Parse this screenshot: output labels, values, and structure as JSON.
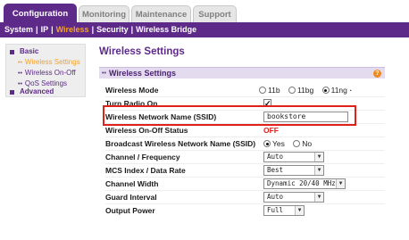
{
  "tabs": [
    {
      "label": "Configuration",
      "active": true
    },
    {
      "label": "Monitoring",
      "active": false
    },
    {
      "label": "Maintenance",
      "active": false
    },
    {
      "label": "Support",
      "active": false
    }
  ],
  "subnav": {
    "items": [
      "System",
      "IP",
      "Wireless",
      "Security",
      "Wireless Bridge"
    ],
    "current": "Wireless"
  },
  "sidebar": {
    "group_basic": "Basic",
    "items": [
      "Wireless Settings",
      "Wireless On-Off",
      "QoS Settings"
    ],
    "active_item": "Wireless Settings",
    "group_advanced": "Advanced"
  },
  "page": {
    "title": "Wireless Settings",
    "panel_title": "Wireless Settings"
  },
  "fields": {
    "wireless_mode": {
      "label": "Wireless Mode",
      "options": [
        "11b",
        "11bg",
        "11ng"
      ],
      "selected": "11ng"
    },
    "turn_radio_on": {
      "label": "Turn Radio On",
      "checked": true
    },
    "ssid": {
      "label": "Wireless Network Name (SSID)",
      "value": "bookstore"
    },
    "onoff_status": {
      "label": "Wireless On-Off Status",
      "value": "OFF"
    },
    "broadcast_ssid": {
      "label": "Broadcast Wireless Network Name (SSID)",
      "options": [
        "Yes",
        "No"
      ],
      "selected": "Yes"
    },
    "channel": {
      "label": "Channel / Frequency",
      "value": "Auto"
    },
    "mcs": {
      "label": "MCS Index / Data Rate",
      "value": "Best"
    },
    "channel_width": {
      "label": "Channel Width",
      "value": "Dynamic 20/40 MHz"
    },
    "guard_interval": {
      "label": "Guard Interval",
      "value": "Auto"
    },
    "output_power": {
      "label": "Output Power",
      "value": "Full"
    }
  },
  "colors": {
    "brand_purple": "#5e2a8a",
    "accent_orange": "#f3a22a",
    "highlight_red": "#e0201a"
  },
  "icons": {
    "help": "help-icon",
    "wifi": "wifi-signal-icon"
  }
}
